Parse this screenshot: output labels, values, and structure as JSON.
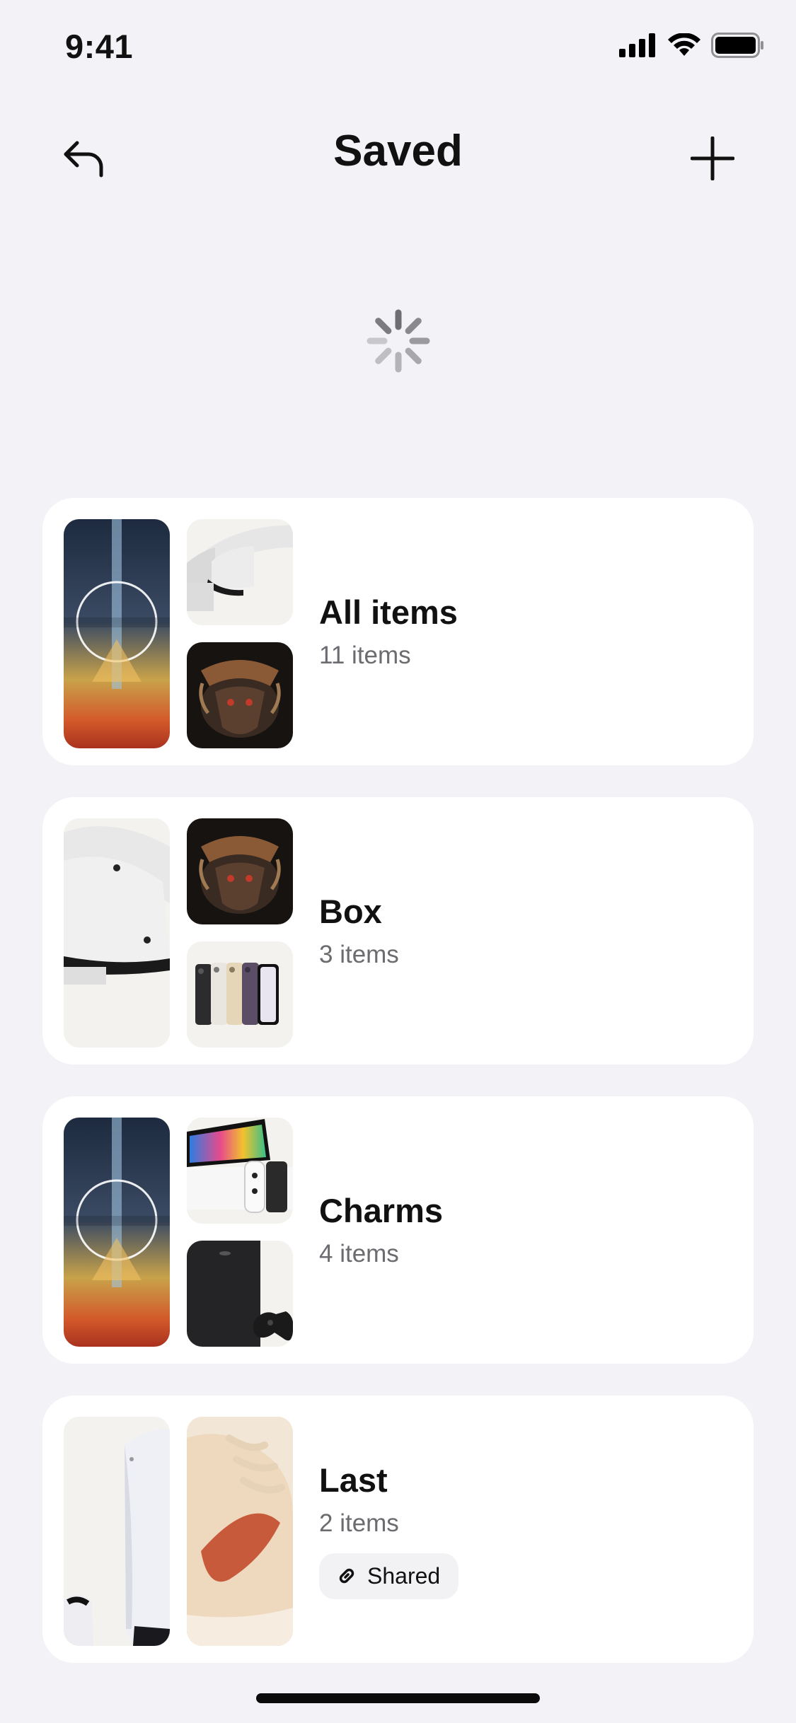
{
  "status_bar": {
    "time": "9:41"
  },
  "nav": {
    "title": "Saved",
    "back_icon": "undo-arrow-icon",
    "add_icon": "plus-icon"
  },
  "loading": {
    "icon": "spinner-icon"
  },
  "collections": [
    {
      "title": "All items",
      "count": "11 items",
      "thumbs": [
        "starfield-cover",
        "vr-headset",
        "baldurs-gate-cover"
      ]
    },
    {
      "title": "Box",
      "count": "3 items",
      "thumbs": [
        "vr-headset",
        "baldurs-gate-cover",
        "iphone-lineup"
      ]
    },
    {
      "title": "Charms",
      "count": "4 items",
      "thumbs": [
        "starfield-cover",
        "switch-oled",
        "xbox-series-x"
      ]
    },
    {
      "title": "Last",
      "count": "2 items",
      "thumbs": [
        "ps5-console",
        "sneaker"
      ],
      "badge": "Shared",
      "badge_icon": "link-icon"
    }
  ],
  "colors": {
    "background": "#f2f2f7",
    "card": "#ffffff",
    "muted_text": "#6b6b70"
  }
}
